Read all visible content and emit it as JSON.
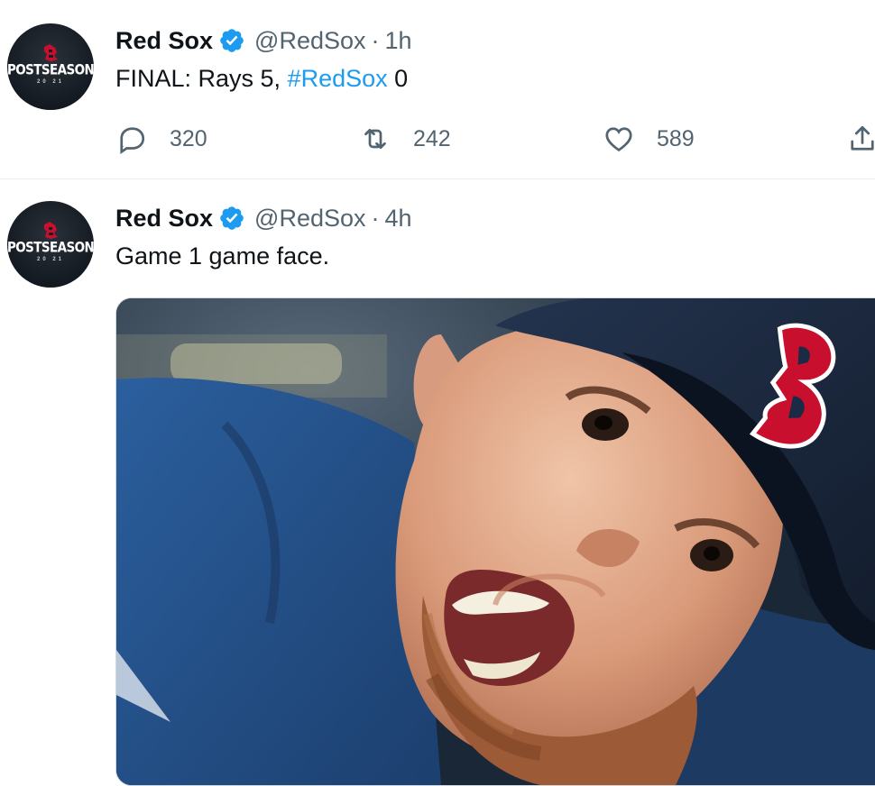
{
  "tweets": [
    {
      "avatar": {
        "logo_icon": "red-sox-b-icon",
        "text": "POSTSEASON",
        "year": "20 21"
      },
      "name": "Red Sox",
      "verified_icon": "verified-badge-icon",
      "handle": "@RedSox",
      "separator": "·",
      "time": "1h",
      "text_parts": [
        "FINAL: Rays 5, ",
        "#RedSox",
        " 0"
      ],
      "actions": {
        "reply_count": "320",
        "retweet_count": "242",
        "like_count": "589"
      }
    },
    {
      "avatar": {
        "logo_icon": "red-sox-b-icon",
        "text": "POSTSEASON",
        "year": "20 21"
      },
      "name": "Red Sox",
      "verified_icon": "verified-badge-icon",
      "handle": "@RedSox",
      "separator": "·",
      "time": "4h",
      "text": "Game 1 game face.",
      "media": {
        "type": "photo",
        "subject": "player-game-face-photo"
      }
    }
  ],
  "colors": {
    "text": "#0f1419",
    "secondary": "#536471",
    "hashtag": "#1d9bf0",
    "verified": "#1d9bf0",
    "cap_navy": "#1b2b45",
    "sox_red": "#c8102e"
  },
  "icons": {
    "reply": "reply-icon",
    "retweet": "retweet-icon",
    "like": "heart-icon",
    "share": "share-icon"
  }
}
